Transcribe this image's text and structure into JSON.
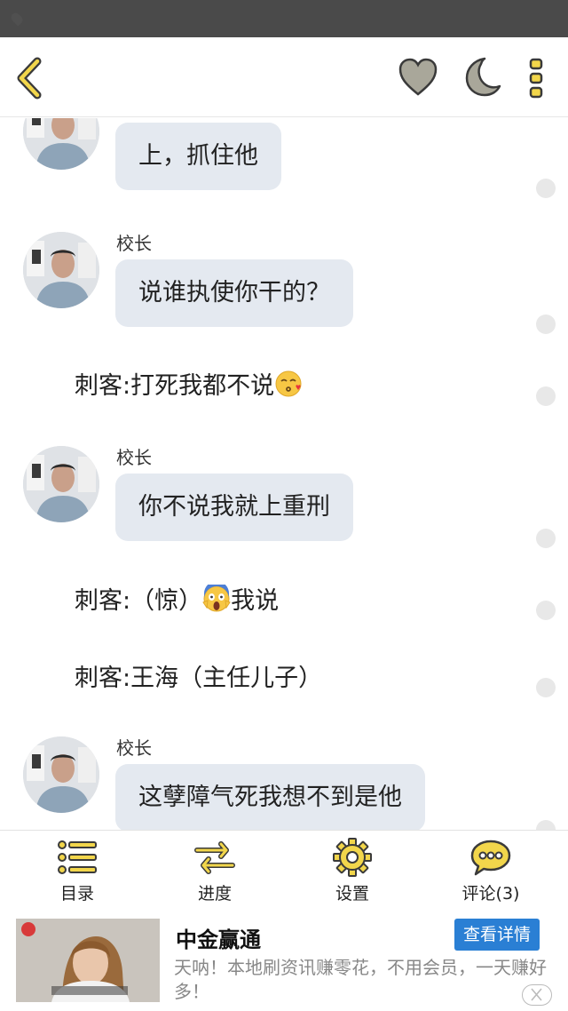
{
  "topbar": {
    "back_icon": "back-chevron-icon",
    "favorite_icon": "heart-icon",
    "night_icon": "moon-icon",
    "more_icon": "more-vertical-icon",
    "accent": "#f2d64b"
  },
  "chat": {
    "messages": [
      {
        "type": "bubble",
        "speaker": "",
        "text": "上，抓住他"
      },
      {
        "type": "bubble",
        "speaker": "校长",
        "text": "说谁执使你干的？"
      },
      {
        "type": "narration",
        "text": "刺客:打死我都不说",
        "emoji": "kissing-face-emoji"
      },
      {
        "type": "bubble",
        "speaker": "校长",
        "text": "你不说我就上重刑"
      },
      {
        "type": "narration",
        "text_before": "刺客:（惊）",
        "emoji": "screaming-face-emoji",
        "text_after": "我说"
      },
      {
        "type": "narration",
        "text": "刺客:王海（主任儿子）"
      },
      {
        "type": "bubble",
        "speaker": "校长",
        "text": "这孽障气死我想不到是他"
      }
    ]
  },
  "bottom_menu": [
    {
      "label": "目录",
      "icon": "list-icon"
    },
    {
      "label": "进度",
      "icon": "swap-arrows-icon"
    },
    {
      "label": "设置",
      "icon": "gear-icon"
    },
    {
      "label": "评论(3)",
      "icon": "chat-bubble-icon"
    }
  ],
  "ad": {
    "title": "中金赢通",
    "button": "查看详情",
    "description": "天呐！本地刷资讯赚零花，不用会员，一天赚好多！",
    "button_color": "#2a7fd4"
  }
}
